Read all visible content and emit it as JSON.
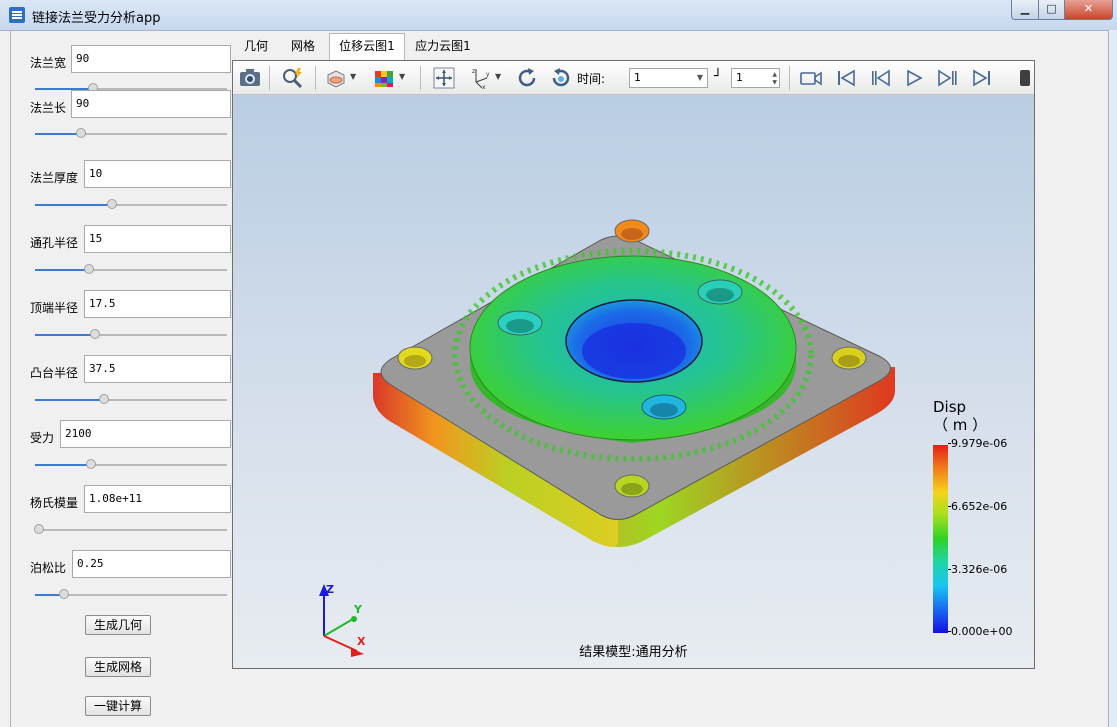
{
  "window": {
    "title": "链接法兰受力分析app",
    "controls": [
      "minimize",
      "maximize",
      "close"
    ]
  },
  "params": [
    {
      "label": "法兰宽",
      "value": "90",
      "slider_fraction": 0.3
    },
    {
      "label": "法兰长",
      "value": "90",
      "slider_fraction": 0.24
    },
    {
      "label": "法兰厚度",
      "value": "10",
      "slider_fraction": 0.4
    },
    {
      "label": "通孔半径",
      "value": "15",
      "slider_fraction": 0.28
    },
    {
      "label": "顶端半径",
      "value": "17.5",
      "slider_fraction": 0.31
    },
    {
      "label": "凸台半径",
      "value": "37.5",
      "slider_fraction": 0.36
    },
    {
      "label": "受力",
      "value": "2100",
      "slider_fraction": 0.29
    },
    {
      "label": "杨氏模量",
      "value": "1.08e+11",
      "slider_fraction": 0.02
    },
    {
      "label": "泊松比",
      "value": "0.25",
      "slider_fraction": 0.15
    }
  ],
  "buttons": {
    "generate_geometry": "生成几何",
    "generate_mesh": "生成网格",
    "compute": "一键计算"
  },
  "tabs": [
    {
      "label": "几何",
      "active": false
    },
    {
      "label": "网格",
      "active": false
    },
    {
      "label": "位移云图1",
      "active": true
    },
    {
      "label": "应力云图1",
      "active": false
    }
  ],
  "toolbar": {
    "icons": [
      "camera-icon",
      "zoom-icon",
      "section-icon",
      "colormap-icon",
      "fit-view-icon",
      "axes-icon",
      "rotate-icon",
      "reset-rotate-icon"
    ],
    "time_label": "时间:",
    "time_value": "1",
    "end_mark": "┘",
    "frame_value": "1",
    "playback_icons": [
      "record-icon",
      "first-frame-icon",
      "prev-frame-icon",
      "play-icon",
      "next-frame-icon",
      "last-frame-icon"
    ]
  },
  "legend": {
    "title_line1": "Disp",
    "title_line2": "（ m ）",
    "ticks": [
      "9.979e-06",
      "6.652e-06",
      "3.326e-06",
      "0.000e+00"
    ],
    "colors": [
      "#e51e14",
      "#f5d21a",
      "#2fd226",
      "#19c4f2",
      "#1410e0"
    ]
  },
  "axes": {
    "z": "Z",
    "y": "Y",
    "x": "X"
  },
  "caption": "结果模型:通用分析"
}
